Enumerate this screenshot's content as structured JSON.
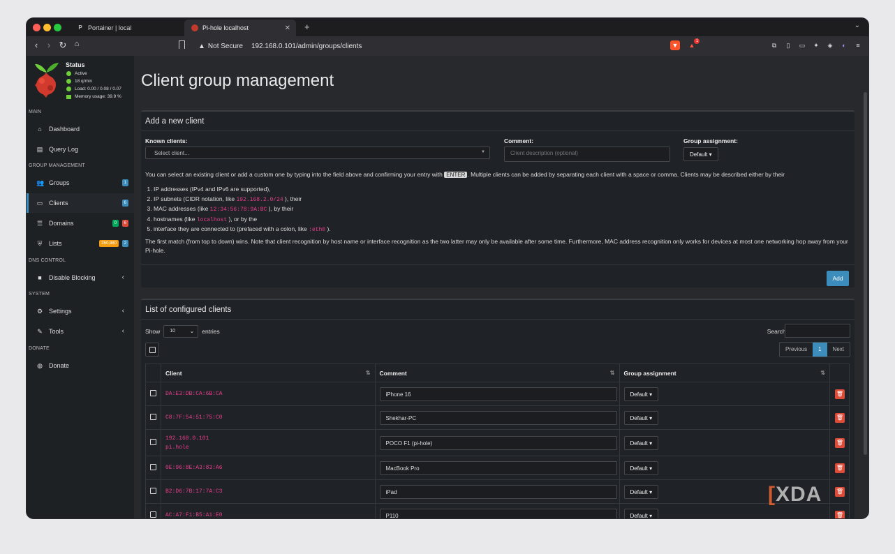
{
  "browser": {
    "tabs": [
      {
        "label": "Portainer | local"
      },
      {
        "label": "Pi-hole localhost"
      }
    ],
    "not_secure": "Not Secure",
    "url": "192.168.0.101/admin/groups/clients",
    "rewards_badge": "1"
  },
  "sidebar": {
    "status_title": "Status",
    "status_lines": [
      "Active",
      "18 q/min",
      "Load: 0.00 / 0.08 / 0.07",
      "Memory usage: 39.9 %"
    ],
    "sections": {
      "main": "MAIN",
      "group_management": "GROUP MANAGEMENT",
      "dns_control": "DNS CONTROL",
      "system": "SYSTEM",
      "donate": "DONATE"
    },
    "items": {
      "dashboard": "Dashboard",
      "query_log": "Query Log",
      "groups": "Groups",
      "groups_badge": "1",
      "clients": "Clients",
      "clients_badge": "6",
      "domains": "Domains",
      "domains_badge_allow": "0",
      "domains_badge_deny": "6",
      "lists": "Lists",
      "lists_badge_count": "350,880",
      "lists_badge_lists": "2",
      "disable_blocking": "Disable Blocking",
      "settings": "Settings",
      "tools": "Tools",
      "donate": "Donate"
    }
  },
  "main": {
    "page_title": "Client group management",
    "add_box": {
      "title": "Add a new client",
      "known_clients_label": "Known clients:",
      "select_placeholder": "Select client...",
      "comment_label": "Comment:",
      "comment_placeholder": "Client description (optional)",
      "group_label": "Group assignment:",
      "group_value": "Default",
      "help_1": "You can select an existing client or add a custom one by typing into the field above and confirming your entry with",
      "help_key": "ENTER",
      "help_2": ". Multiple clients can be added by separating each client with a space or comma. Clients may be described either by their",
      "list": [
        {
          "pre": "IP addresses (IPv4 and IPv6 are supported),",
          "code": "",
          "post": ""
        },
        {
          "pre": "IP subnets (CIDR notation, like",
          "code": "192.168.2.0/24",
          "post": "), their"
        },
        {
          "pre": "MAC addresses (like",
          "code": "12:34:56:78:9A:BC",
          "post": "), by their"
        },
        {
          "pre": "hostnames (like",
          "code": "localhost",
          "post": "), or by the"
        },
        {
          "pre": "interface they are connected to (prefaced with a colon, like",
          "code": ":eth0",
          "post": ")."
        }
      ],
      "note": "The first match (from top to down) wins. Note that client recognition by host name or interface recognition as the two latter may only be available after some time. Furthermore, MAC address recognition only works for devices at most one networking hop away from your Pi-hole.",
      "add_button": "Add"
    },
    "list_box": {
      "title": "List of configured clients",
      "show_label": "Show",
      "show_value": "10",
      "entries_label": "entries",
      "search_label": "Search:",
      "pager": {
        "previous": "Previous",
        "current": "1",
        "next": "Next"
      },
      "columns": [
        "Client",
        "Comment",
        "Group assignment"
      ],
      "rows": [
        {
          "client": "DA:E3:DB:CA:6B:CA",
          "client2": "",
          "comment": "iPhone 16",
          "group": "Default"
        },
        {
          "client": "C8:7F:54:51:75:C0",
          "client2": "",
          "comment": "Shekhar-PC",
          "group": "Default"
        },
        {
          "client": "192.168.0.101",
          "client2": "pi.hole",
          "comment": "POCO F1 (pi-hole)",
          "group": "Default"
        },
        {
          "client": "0E:96:8E:A3:83:A6",
          "client2": "",
          "comment": "MacBook Pro",
          "group": "Default"
        },
        {
          "client": "B2:D6:7B:17:7A:C3",
          "client2": "",
          "comment": "iPad",
          "group": "Default"
        },
        {
          "client": "AC:A7:F1:B5:A1:E0",
          "client2": "",
          "comment": "P110",
          "group": "Default"
        }
      ]
    }
  },
  "watermark": "XDA"
}
